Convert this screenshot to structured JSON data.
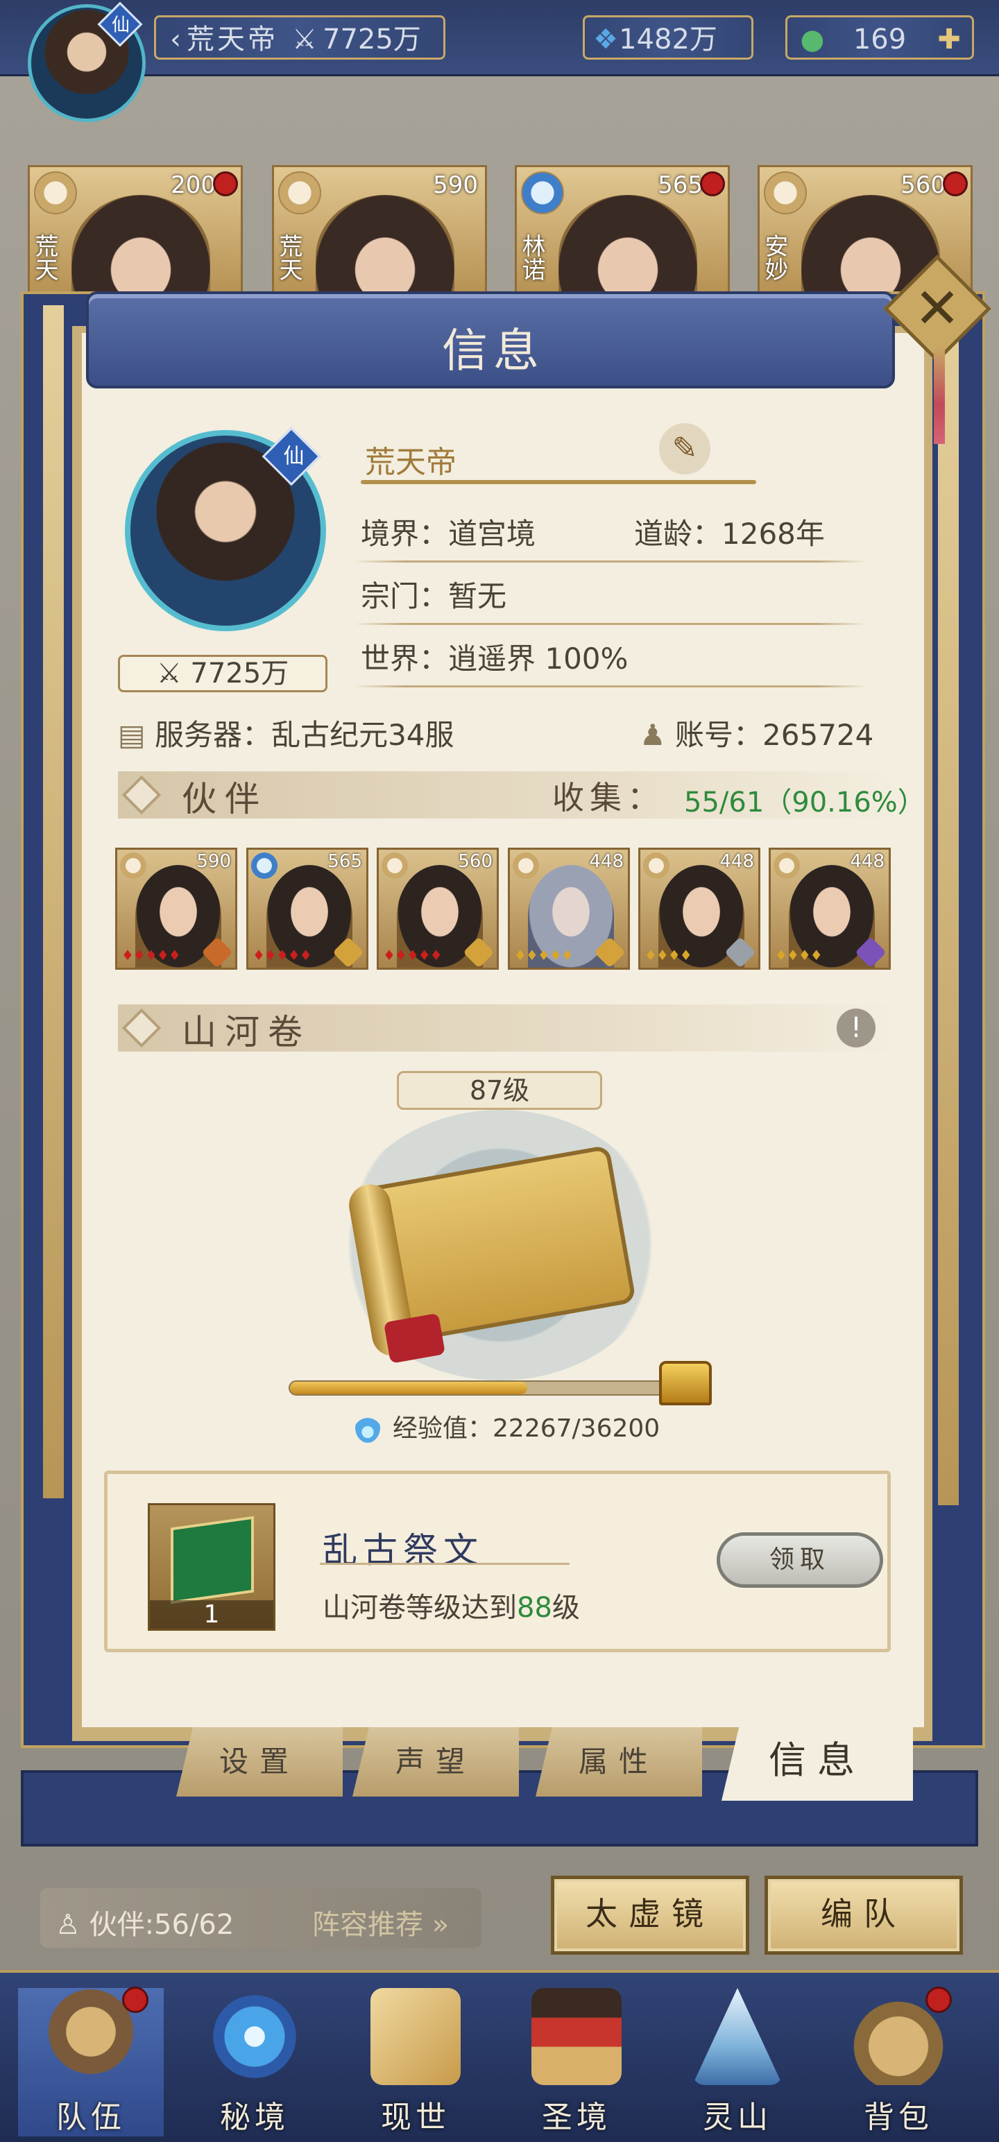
{
  "topbar": {
    "player_name": "荒天帝",
    "power": "7725万",
    "spirit_stones": "1482万",
    "jade": "169",
    "avatar_badge": "仙"
  },
  "heroes": [
    {
      "name": "荒天",
      "power": "200"
    },
    {
      "name": "荒天",
      "power": "590"
    },
    {
      "name": "林诺",
      "power": "565"
    },
    {
      "name": "安妙",
      "power": "560"
    }
  ],
  "panel": {
    "title": "信息",
    "close_label": "✕"
  },
  "profile": {
    "name": "荒天帝",
    "badge": "仙",
    "power": "7725万",
    "realm_label": "境界：",
    "realm_value": "道宫境",
    "age_label": "道龄：",
    "age_value": "1268年",
    "sect_label": "宗门：",
    "sect_value": "暂无",
    "world_label": "世界：",
    "world_value": "逍遥界 100%",
    "server_label": "服务器：",
    "server_value": "乱古纪元34服",
    "account_label": "账号：",
    "account_value": "265724"
  },
  "partners_section": {
    "title": "伙伴",
    "collect_label": "收集：",
    "collect_value": "55/61（90.16%）",
    "cards": [
      {
        "level": "590",
        "gems": "♦♦♦♦♦",
        "gem_color": "red",
        "tag_color": "#c86a2a"
      },
      {
        "level": "565",
        "gems": "♦♦♦♦♦",
        "gem_color": "red",
        "tag_color": "#d4a23a"
      },
      {
        "level": "560",
        "gems": "♦♦♦♦♦",
        "gem_color": "red",
        "tag_color": "#d4a23a"
      },
      {
        "level": "448",
        "gems": "♦♦♦♦♦",
        "gem_color": "gold",
        "tag_color": "#d4a23a"
      },
      {
        "level": "448",
        "gems": "♦♦♦♦",
        "gem_color": "gold",
        "tag_color": "#9aa0a8"
      },
      {
        "level": "448",
        "gems": "♦♦♦♦",
        "gem_color": "gold",
        "tag_color": "#7a52b8"
      }
    ]
  },
  "shanhe": {
    "title": "山河卷",
    "level": "87级",
    "exp_label": "经验值：",
    "exp_value": "22267/36200",
    "exp_fraction": 0.615
  },
  "task": {
    "title": "乱古祭文",
    "desc_prefix": "山河卷等级达到",
    "desc_level": "88",
    "desc_suffix": "级",
    "item_qty": "1",
    "claim_label": "领取"
  },
  "tabs": [
    {
      "label": "设置",
      "active": false
    },
    {
      "label": "声望",
      "active": false
    },
    {
      "label": "属性",
      "active": false
    },
    {
      "label": "信息",
      "active": true
    }
  ],
  "bottom": {
    "partners_count": "伙伴:56/62",
    "recommend": "阵容推荐",
    "btn_mirror": "太虚镜",
    "btn_team": "编队"
  },
  "nav": [
    {
      "label": "队伍",
      "icon": "hat-icon",
      "dot": true
    },
    {
      "label": "秘境",
      "icon": "vortex-icon",
      "dot": false
    },
    {
      "label": "现世",
      "icon": "map-scroll-icon",
      "dot": false
    },
    {
      "label": "圣境",
      "icon": "temple-icon",
      "dot": false
    },
    {
      "label": "灵山",
      "icon": "mountain-icon",
      "dot": false
    },
    {
      "label": "背包",
      "icon": "bag-icon",
      "dot": true
    }
  ],
  "colors": {
    "panel_blue": "#2d3f73",
    "gold_border": "#c2a35e",
    "paper": "#f3eee0",
    "highlight_green": "#2e8b3c"
  }
}
